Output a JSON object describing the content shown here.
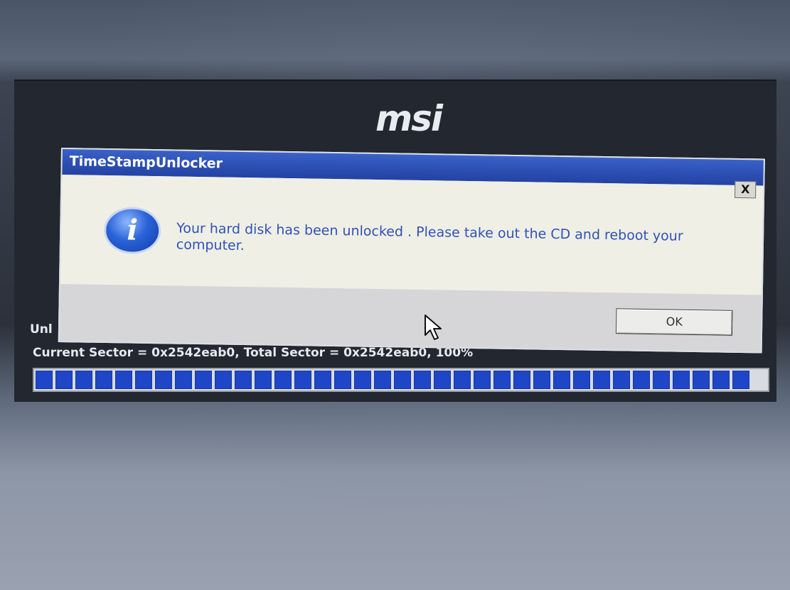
{
  "brand": {
    "logo_text": "msi"
  },
  "dialog": {
    "title": "TimeStampUnlocker",
    "close_label": "X",
    "icon": "info-icon",
    "icon_glyph": "i",
    "message": "Your hard disk has been unlocked . Please take out the CD and reboot your computer.",
    "ok_label": "OK"
  },
  "background": {
    "status_partial": "Unl",
    "sector_line": "Current Sector = 0x2542eab0, Total Sector = 0x2542eab0, 100%"
  },
  "progress": {
    "fraction": 1.0
  },
  "colors": {
    "titlebar_blue": "#2c4fb4",
    "progress_blue": "#1e46c6",
    "message_text": "#2f52b8"
  }
}
